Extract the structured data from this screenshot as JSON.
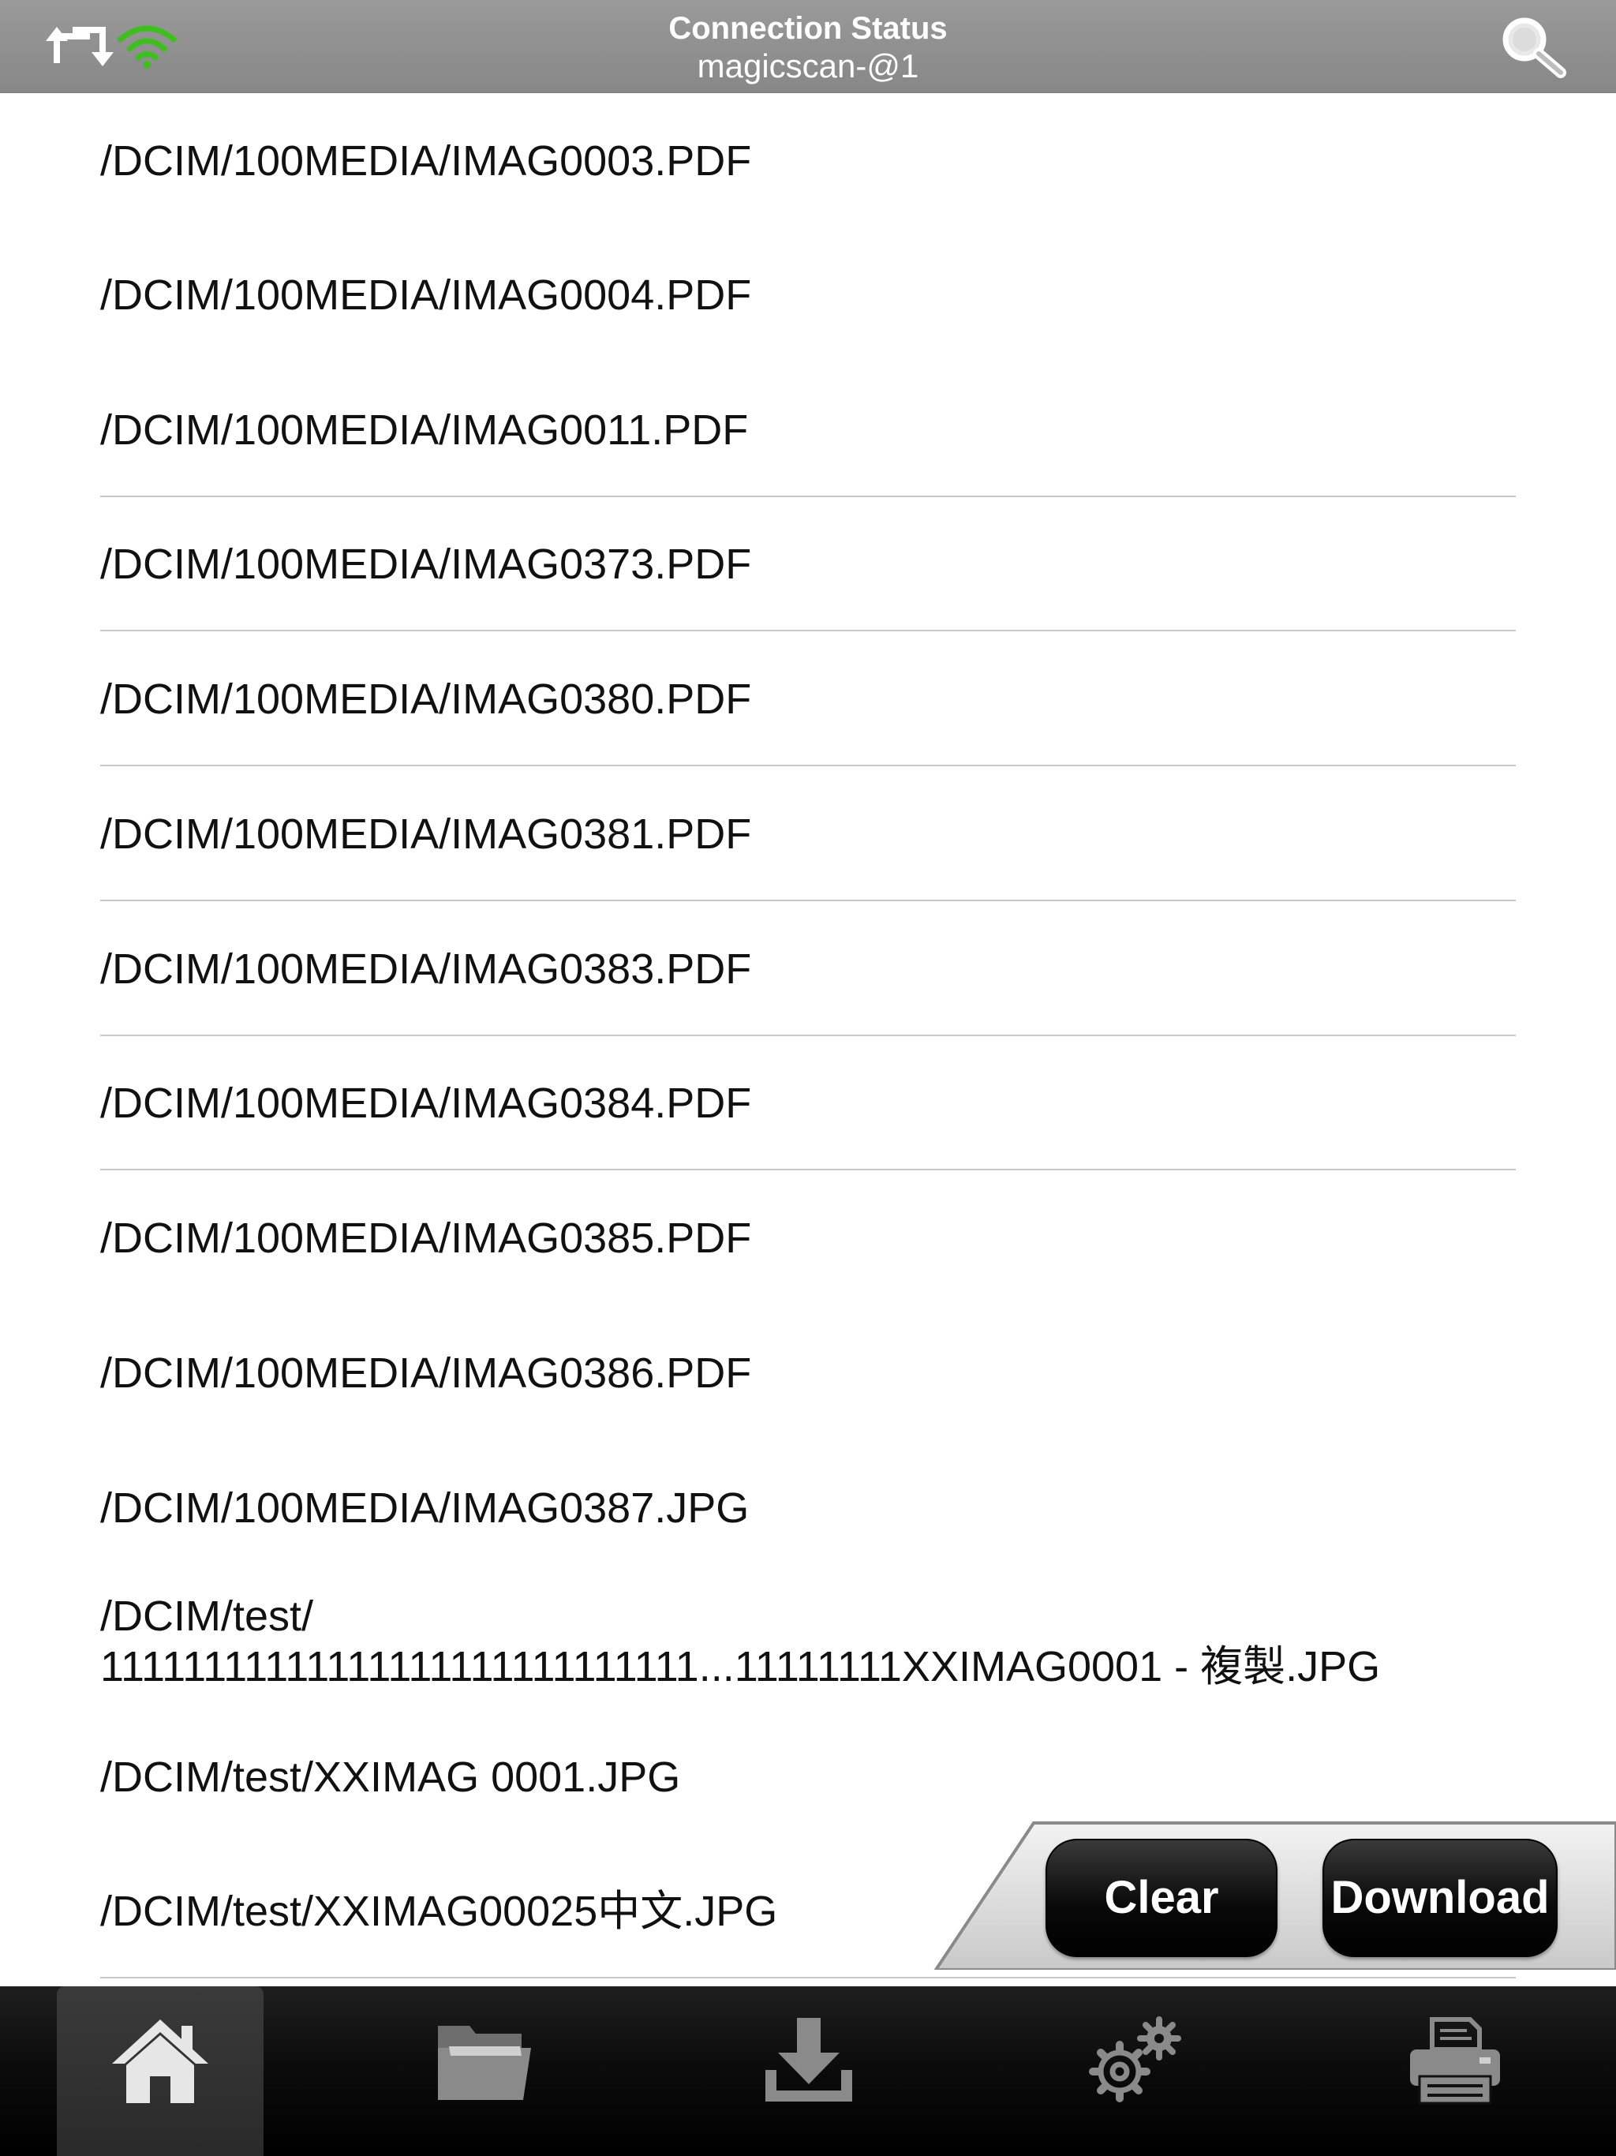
{
  "header": {
    "title": "Connection Status",
    "subtitle": "magicscan-@1",
    "left_icons": [
      "sync-icon",
      "wifi-icon"
    ],
    "right_icon": "search-icon",
    "wifi_color": "#3fbf1f"
  },
  "files": [
    "/DCIM/100MEDIA/IMAG0003.PDF",
    "/DCIM/100MEDIA/IMAG0004.PDF",
    "/DCIM/100MEDIA/IMAG0011.PDF",
    "/DCIM/100MEDIA/IMAG0373.PDF",
    "/DCIM/100MEDIA/IMAG0380.PDF",
    "/DCIM/100MEDIA/IMAG0381.PDF",
    "/DCIM/100MEDIA/IMAG0383.PDF",
    "/DCIM/100MEDIA/IMAG0384.PDF",
    "/DCIM/100MEDIA/IMAG0385.PDF",
    "/DCIM/100MEDIA/IMAG0386.PDF",
    "/DCIM/100MEDIA/IMAG0387.JPG",
    "/DCIM/test/\n11111111111111111111111111111...11111111XXIMAG0001 - 複製.JPG",
    "/DCIM/test/XXIMAG 0001.JPG",
    "/DCIM/test/XXIMAG00025中文.JPG"
  ],
  "actions": {
    "clear_label": "Clear",
    "download_label": "Download"
  },
  "tabbar": {
    "tabs": [
      {
        "icon": "home-icon",
        "selected": true
      },
      {
        "icon": "folder-icon",
        "selected": false
      },
      {
        "icon": "download-icon",
        "selected": false
      },
      {
        "icon": "settings-icon",
        "selected": false
      },
      {
        "icon": "printer-icon",
        "selected": false
      }
    ]
  }
}
